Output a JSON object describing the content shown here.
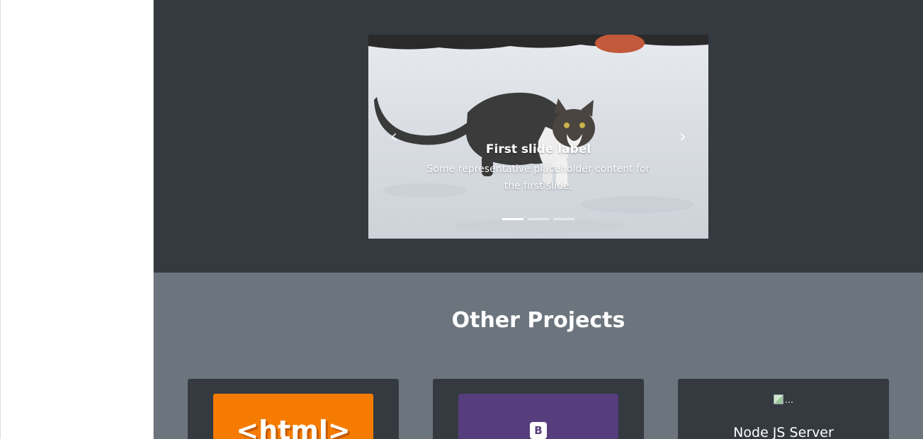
{
  "carousel": {
    "prev_icon": "chevron-left-icon",
    "next_icon": "chevron-right-icon",
    "prev_glyph": "‹",
    "next_glyph": "›",
    "slide": {
      "label": "First slide label",
      "text": "Some representative placeholder content for the first slide."
    },
    "indicators": [
      {
        "active": true
      },
      {
        "active": false
      },
      {
        "active": false
      }
    ]
  },
  "projects": {
    "title": "Other Projects",
    "cards": [
      {
        "logo_text": "<html>",
        "brand_color": "#f57c00"
      },
      {
        "logo_text": "B",
        "brand_color": "#563d7c"
      },
      {
        "img_alt": "...",
        "title": "Node JS Server"
      }
    ]
  },
  "colors": {
    "hero_bg": "#343a40",
    "projects_bg": "#6c757d",
    "card_bg": "#343a40"
  }
}
